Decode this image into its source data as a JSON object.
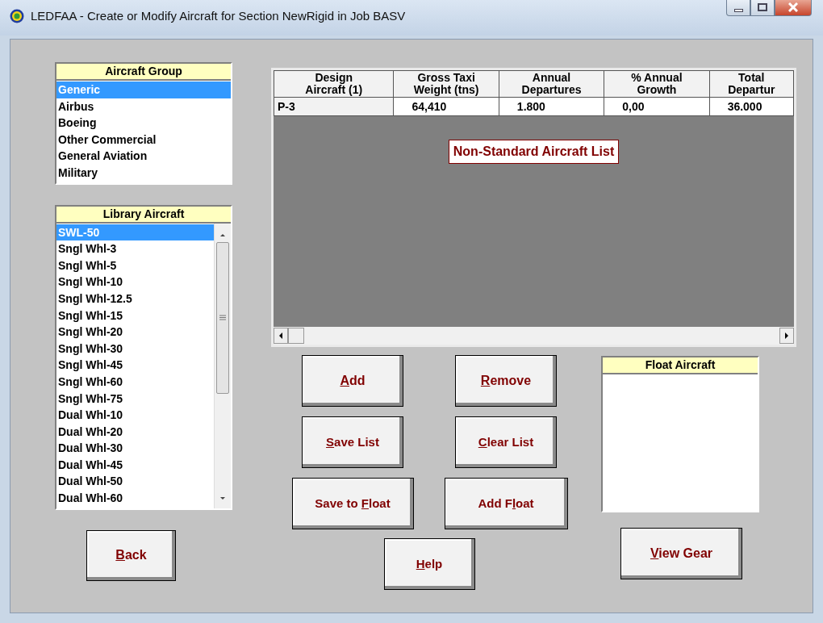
{
  "window": {
    "title": "LEDFAA - Create or Modify Aircraft for Section NewRigid in Job BASV"
  },
  "aircraft_group": {
    "title": "Aircraft Group",
    "items": [
      {
        "label": "Generic",
        "selected": true
      },
      {
        "label": "Airbus",
        "selected": false
      },
      {
        "label": "Boeing",
        "selected": false
      },
      {
        "label": "Other Commercial",
        "selected": false
      },
      {
        "label": "General Aviation",
        "selected": false
      },
      {
        "label": "Military",
        "selected": false
      }
    ]
  },
  "library_aircraft": {
    "title": "Library Aircraft",
    "items": [
      {
        "label": "SWL-50",
        "selected": true
      },
      {
        "label": "Sngl Whl-3",
        "selected": false
      },
      {
        "label": "Sngl Whl-5",
        "selected": false
      },
      {
        "label": "Sngl Whl-10",
        "selected": false
      },
      {
        "label": "Sngl Whl-12.5",
        "selected": false
      },
      {
        "label": "Sngl Whl-15",
        "selected": false
      },
      {
        "label": "Sngl Whl-20",
        "selected": false
      },
      {
        "label": "Sngl Whl-30",
        "selected": false
      },
      {
        "label": "Sngl Whl-45",
        "selected": false
      },
      {
        "label": "Sngl Whl-60",
        "selected": false
      },
      {
        "label": "Sngl Whl-75",
        "selected": false
      },
      {
        "label": "Dual Whl-10",
        "selected": false
      },
      {
        "label": "Dual Whl-20",
        "selected": false
      },
      {
        "label": "Dual Whl-30",
        "selected": false
      },
      {
        "label": "Dual Whl-45",
        "selected": false
      },
      {
        "label": "Dual Whl-50",
        "selected": false
      },
      {
        "label": "Dual Whl-60",
        "selected": false
      }
    ]
  },
  "back_button": {
    "label_parts": [
      {
        "text": "B",
        "underlined": true
      },
      {
        "text": "ack",
        "underlined": false
      }
    ]
  },
  "table": {
    "columns": [
      {
        "heading_lines": [
          "Design",
          "Aircraft (1)"
        ]
      },
      {
        "heading_lines": [
          "Gross Taxi",
          "Weight (tns)"
        ]
      },
      {
        "heading_lines": [
          "Annual",
          "Departures"
        ]
      },
      {
        "heading_lines": [
          "% Annual",
          "Growth"
        ]
      },
      {
        "heading_lines": [
          "Total",
          "Departur"
        ]
      }
    ],
    "rows": [
      [
        "P-3",
        "64,410",
        "1.800",
        "0,00",
        "36.000"
      ]
    ],
    "caption": "Non-Standard Aircraft List"
  },
  "buttons": [
    {
      "label_parts": [
        {
          "text": "A",
          "underlined": true
        },
        {
          "text": "dd",
          "underlined": false
        }
      ]
    },
    {
      "label_parts": [
        {
          "text": "R",
          "underlined": true
        },
        {
          "text": "emove",
          "underlined": false
        }
      ]
    },
    {
      "label_parts": [
        {
          "text": "S",
          "underlined": true
        },
        {
          "text": "ave List",
          "underlined": false
        }
      ]
    },
    {
      "label_parts": [
        {
          "text": "C",
          "underlined": true
        },
        {
          "text": "lear List",
          "underlined": false
        }
      ]
    },
    {
      "label_parts": [
        {
          "text": "Save to ",
          "underlined": false
        },
        {
          "text": "F",
          "underlined": true
        },
        {
          "text": "loat",
          "underlined": false
        }
      ]
    },
    {
      "label_parts": [
        {
          "text": "Add F",
          "underlined": false
        },
        {
          "text": "l",
          "underlined": true
        },
        {
          "text": "oat",
          "underlined": false
        }
      ]
    },
    {
      "label_parts": [
        {
          "text": "H",
          "underlined": true
        },
        {
          "text": "elp",
          "underlined": false
        }
      ]
    }
  ],
  "float_aircraft": {
    "title": "Float Aircraft"
  },
  "view_gear_button": {
    "label_parts": [
      {
        "text": "V",
        "underlined": true
      },
      {
        "text": "iew Gear",
        "underlined": false
      }
    ]
  }
}
